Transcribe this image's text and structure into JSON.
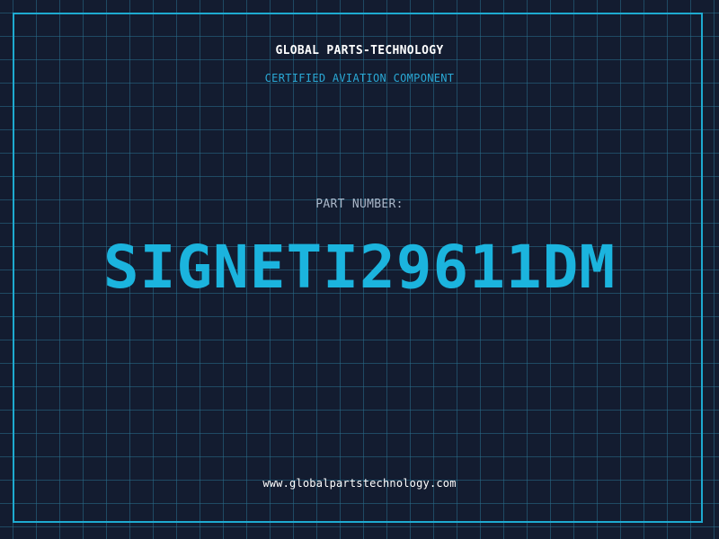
{
  "header": {
    "brand": "GLOBAL PARTS-TECHNOLOGY",
    "subtitle": "CERTIFIED AVIATION COMPONENT"
  },
  "part": {
    "label": "PART NUMBER:",
    "number": "SIGNETI29611DM"
  },
  "footer": {
    "url": "www.globalpartstechnology.com"
  },
  "colors": {
    "background": "#131c30",
    "grid": "#286e8c",
    "accent": "#1bb4de",
    "frame": "#1eaad0",
    "text": "#ffffff",
    "muted": "#aab6c8"
  }
}
